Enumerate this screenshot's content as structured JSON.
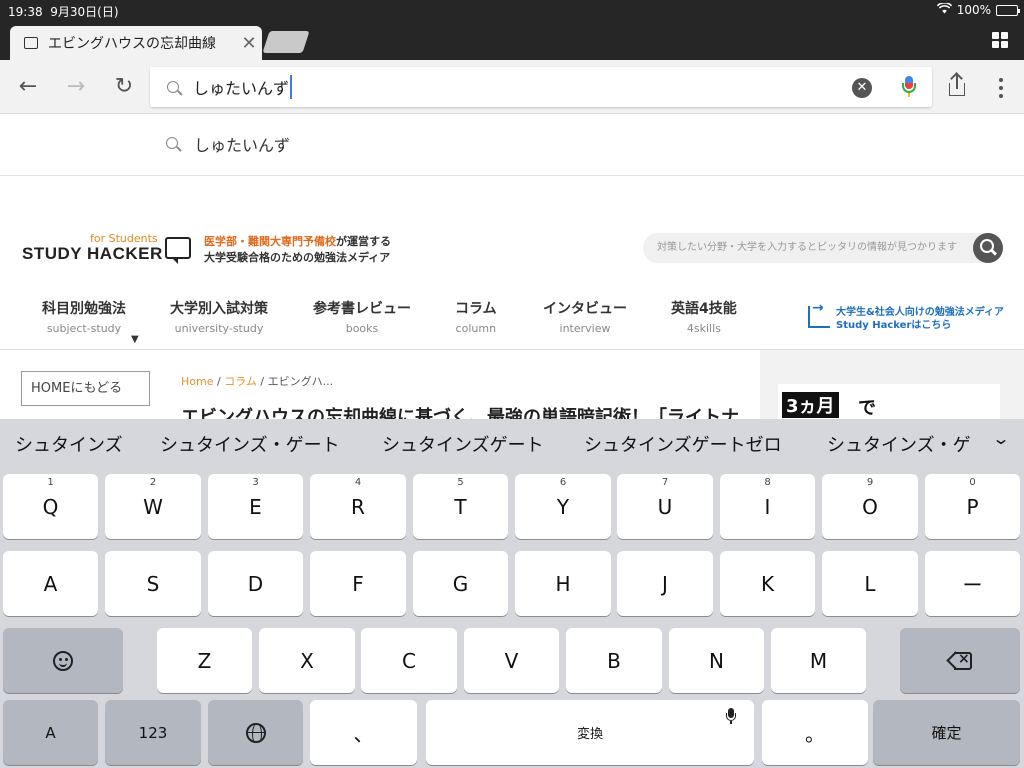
{
  "status_bar": {
    "time": "19:38",
    "date": "9月30日(日)",
    "battery": "100%",
    "battery_level": 1.0
  },
  "tab": {
    "title": "エビングハウスの忘却曲線",
    "close_icon": "close-icon"
  },
  "omnibox": {
    "text": "しゅたいんず"
  },
  "suggestion": {
    "text": "しゅたいんず"
  },
  "site": {
    "logo_for": "for Students",
    "logo_main": "STUDY HACKER",
    "tagline_highlight": "医学部・難関大専門予備校",
    "tagline_rest": "が運営する",
    "tagline_line2": "大学受験合格のための勉強法メディア",
    "search_placeholder": "対策したい分野・大学を入力するとピッタリの情報が見つかります",
    "nav": [
      {
        "jp": "科目別勉強法",
        "en": "subject-study"
      },
      {
        "jp": "大学別入試対策",
        "en": "university-study"
      },
      {
        "jp": "参考書レビュー",
        "en": "books"
      },
      {
        "jp": "コラム",
        "en": "column"
      },
      {
        "jp": "インタビュー",
        "en": "interview"
      },
      {
        "jp": "英語4技能",
        "en": "4skills"
      }
    ],
    "nav_caret": "▼",
    "ext_link_line1": "大学生&社会人向けの勉強法メディア",
    "ext_link_line2": "Study Hackerはこちら",
    "home_button": "HOMEにもどる",
    "breadcrumb": {
      "home": "Home",
      "sep": "/",
      "column": "コラム",
      "current": "エビングハ..."
    },
    "article_title": "エビングハウスの忘却曲線に基づく、最強の単語暗記術！「ライトナ",
    "ad_highlight": "3ヵ月",
    "ad_suffix": "で"
  },
  "keyboard": {
    "candidates": [
      "シュタインズ",
      "シュタインズ・ゲート",
      "シュタインズゲート",
      "シュタインズゲートゼロ",
      "シュタインズ・ゲ"
    ],
    "more_icon": "chevron-down-icon",
    "row1": [
      {
        "key": "Q",
        "hint": "1"
      },
      {
        "key": "W",
        "hint": "2"
      },
      {
        "key": "E",
        "hint": "3"
      },
      {
        "key": "R",
        "hint": "4"
      },
      {
        "key": "T",
        "hint": "5"
      },
      {
        "key": "Y",
        "hint": "6"
      },
      {
        "key": "U",
        "hint": "7"
      },
      {
        "key": "I",
        "hint": "8"
      },
      {
        "key": "O",
        "hint": "9"
      },
      {
        "key": "P",
        "hint": "0"
      }
    ],
    "row2": [
      "A",
      "S",
      "D",
      "F",
      "G",
      "H",
      "J",
      "K",
      "L",
      "ー"
    ],
    "row3": [
      "Z",
      "X",
      "C",
      "V",
      "B",
      "N",
      "M"
    ],
    "row4": {
      "shift_a": "A",
      "num": "123",
      "space": "変換",
      "comma": "、",
      "period": "。",
      "confirm": "確定"
    }
  }
}
